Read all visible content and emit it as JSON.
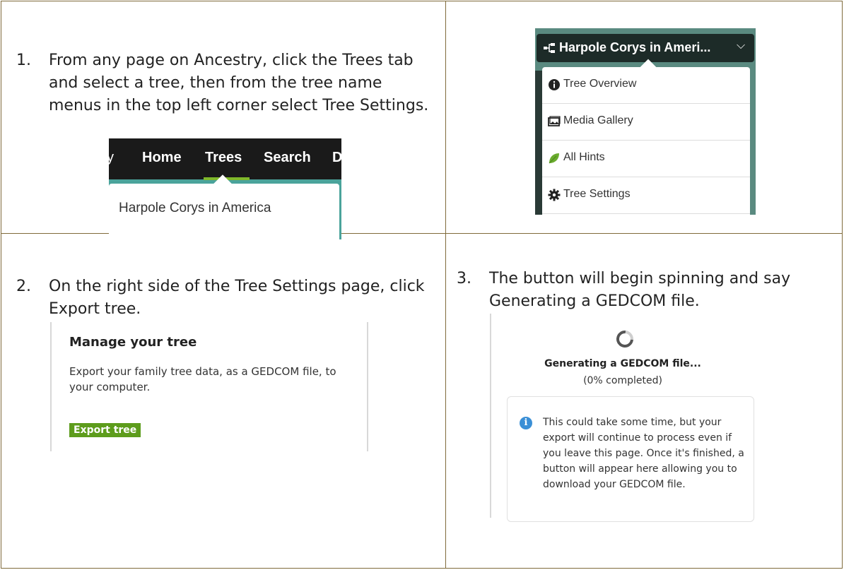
{
  "steps": [
    {
      "num": "1.",
      "text": "From any page on Ancestry, click the Trees tab and select a tree, then from the tree name menus in the top left corner select Tree Settings."
    },
    {
      "num": "2.",
      "text": "On the right side of the Tree Settings page, click Export tree."
    },
    {
      "num": "3.",
      "text": "The button will begin spinning and say Generating a GEDCOM file."
    }
  ],
  "nav": {
    "partial_left": "y",
    "items": [
      "Home",
      "Trees",
      "Search",
      "D"
    ],
    "active": "Trees",
    "dropdown_item": "Harpole Corys in America"
  },
  "tree_menu": {
    "title": "Harpole Corys in Ameri...",
    "items": [
      {
        "label": "Tree Overview",
        "icon": "info-icon"
      },
      {
        "label": "Media Gallery",
        "icon": "gallery-icon"
      },
      {
        "label": "All Hints",
        "icon": "leaf-icon"
      },
      {
        "label": "Tree Settings",
        "icon": "gear-icon"
      }
    ]
  },
  "manage": {
    "heading": "Manage your tree",
    "description": "Export your family tree data, as a GEDCOM file, to your computer.",
    "button": "Export tree"
  },
  "generating": {
    "status": "Generating a GEDCOM file...",
    "progress_text": "(0% completed)",
    "progress": 0,
    "message": "This could take some time, but your export will continue to process even if you leave this page. Once it's finished, a button will appear here allowing you to download your GEDCOM file."
  },
  "colors": {
    "border": "#7f6a3a",
    "accent_green": "#7fb82a",
    "button_green": "#5d9c1c",
    "info_blue": "#3a8fd6"
  }
}
